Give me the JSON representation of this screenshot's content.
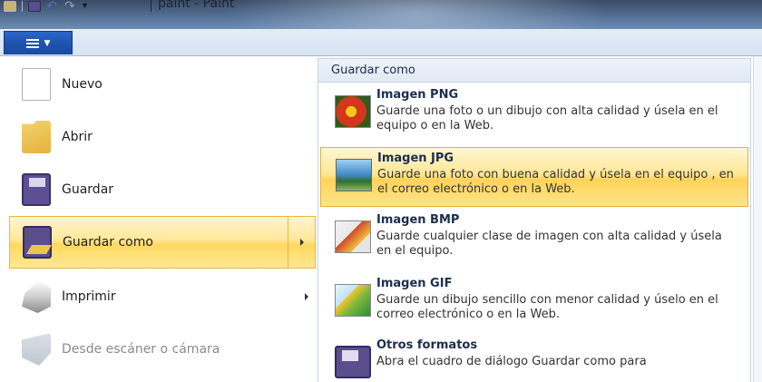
{
  "window": {
    "title": "paint - Paint"
  },
  "file_menu": {
    "left_items": [
      {
        "label": "Nuevo",
        "icon": "new-document-icon"
      },
      {
        "label": "Abrir",
        "icon": "open-folder-icon"
      },
      {
        "label": "Guardar",
        "icon": "save-floppy-icon"
      },
      {
        "label": "Guardar como",
        "icon": "save-as-icon",
        "active": true
      },
      {
        "label": "Imprimir",
        "icon": "printer-icon"
      },
      {
        "label": "Desde escáner o cámara",
        "icon": "scanner-icon",
        "disabled": true
      }
    ],
    "save_as": {
      "header": "Guardar como",
      "items": [
        {
          "title": "Imagen PNG",
          "description": "Guarde una foto o un dibujo con alta calidad y úsela en el equipo o en la Web.",
          "icon": "png-image-icon"
        },
        {
          "title": "Imagen JPG",
          "description": "Guarde una foto con buena calidad y úsela en el equipo , en el correo electrónico o en la Web.",
          "icon": "jpg-image-icon",
          "active": true
        },
        {
          "title": "Imagen BMP",
          "description": "Guarde cualquier clase de imagen con alta calidad y úsela en el equipo.",
          "icon": "bmp-image-icon"
        },
        {
          "title": "Imagen GIF",
          "description": "Guarde un dibujo sencillo con menor calidad y úselo en el correo electrónico o en la Web.",
          "icon": "gif-image-icon"
        },
        {
          "title": "Otros formatos",
          "description": "Abra el cuadro de diálogo Guardar como para",
          "icon": "other-formats-icon"
        }
      ]
    }
  },
  "colors": {
    "highlight_top": "#fff6cf",
    "highlight_mid": "#ffd862",
    "highlight_border": "#e6b54a",
    "file_tab": "#1e52ad"
  }
}
